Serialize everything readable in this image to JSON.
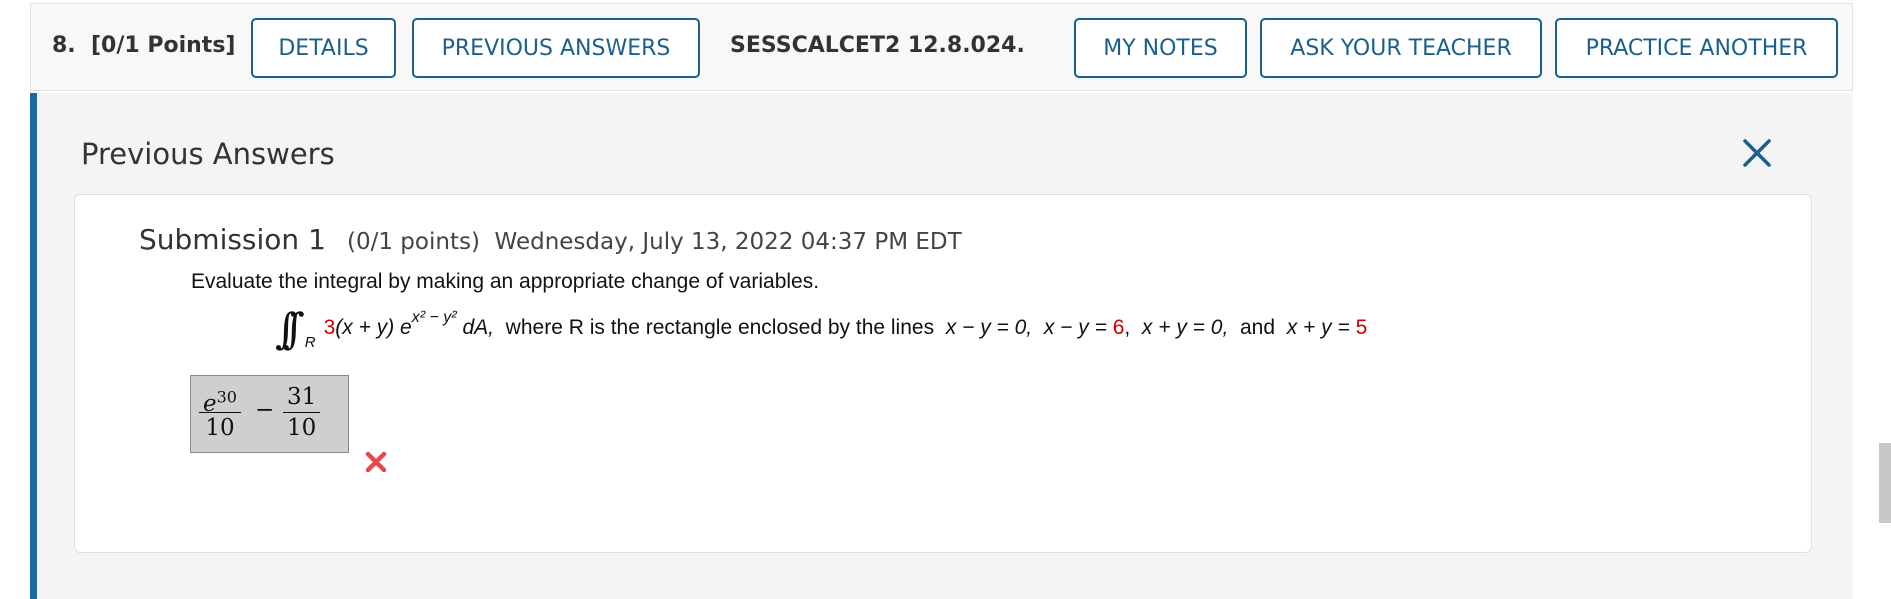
{
  "question": {
    "number": "8.",
    "points": "[0/1 Points]",
    "buttons": {
      "details": "DETAILS",
      "previous_answers": "PREVIOUS ANSWERS",
      "my_notes": "MY NOTES",
      "ask_teacher": "ASK YOUR TEACHER",
      "practice_another": "PRACTICE ANOTHER"
    },
    "id": "SESSCALCET2 12.8.024."
  },
  "panel": {
    "title": "Previous Answers",
    "close_icon": "close-icon"
  },
  "submission": {
    "title": "Submission 1",
    "points": "(0/1 points)",
    "timestamp": "Wednesday, July 13, 2022 04:37 PM EDT",
    "instruction": "Evaluate the integral by making an appropriate change of variables.",
    "formula": {
      "integral_symbol": "∫∫",
      "region": "R",
      "coef": "3",
      "factor": "(x + y) e",
      "exponent": "x² − y²",
      "differential": "dA,",
      "where_text": "where R is the rectangle enclosed by the lines",
      "line1": "x − y = 0,",
      "line2_lhs": "x − y =",
      "line2_val": "6",
      "line3": "x + y = 0,",
      "and_text": "and",
      "line4_lhs": "x + y =",
      "line4_val": "5"
    },
    "answer": {
      "frac1_num": "e30",
      "frac1_den": "10",
      "minus": "−",
      "frac2_num": "31",
      "frac2_den": "10"
    },
    "status_icon": "incorrect-x-icon"
  },
  "colors": {
    "accent": "#1b5f8a",
    "panel_border": "#1a6aa1",
    "error": "#e8474e",
    "highlight": "#cc0000"
  }
}
